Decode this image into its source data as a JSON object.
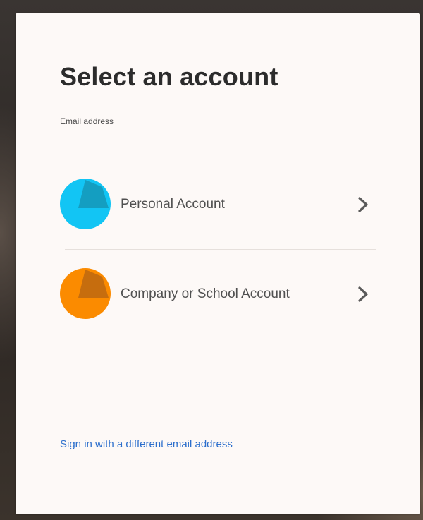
{
  "dialog": {
    "title": "Select an account",
    "email_label": "Email address",
    "email_value": ""
  },
  "accounts": [
    {
      "label": "Personal Account",
      "icon": "personal-account-icon",
      "color": "#12c5f4",
      "shade": "#149ec1"
    },
    {
      "label": "Company or School Account",
      "icon": "company-account-icon",
      "color": "#fb8b00",
      "shade": "#c66d0e"
    }
  ],
  "footer": {
    "link_label": "Sign in with a different email address",
    "link_color": "#2b6ecc"
  }
}
